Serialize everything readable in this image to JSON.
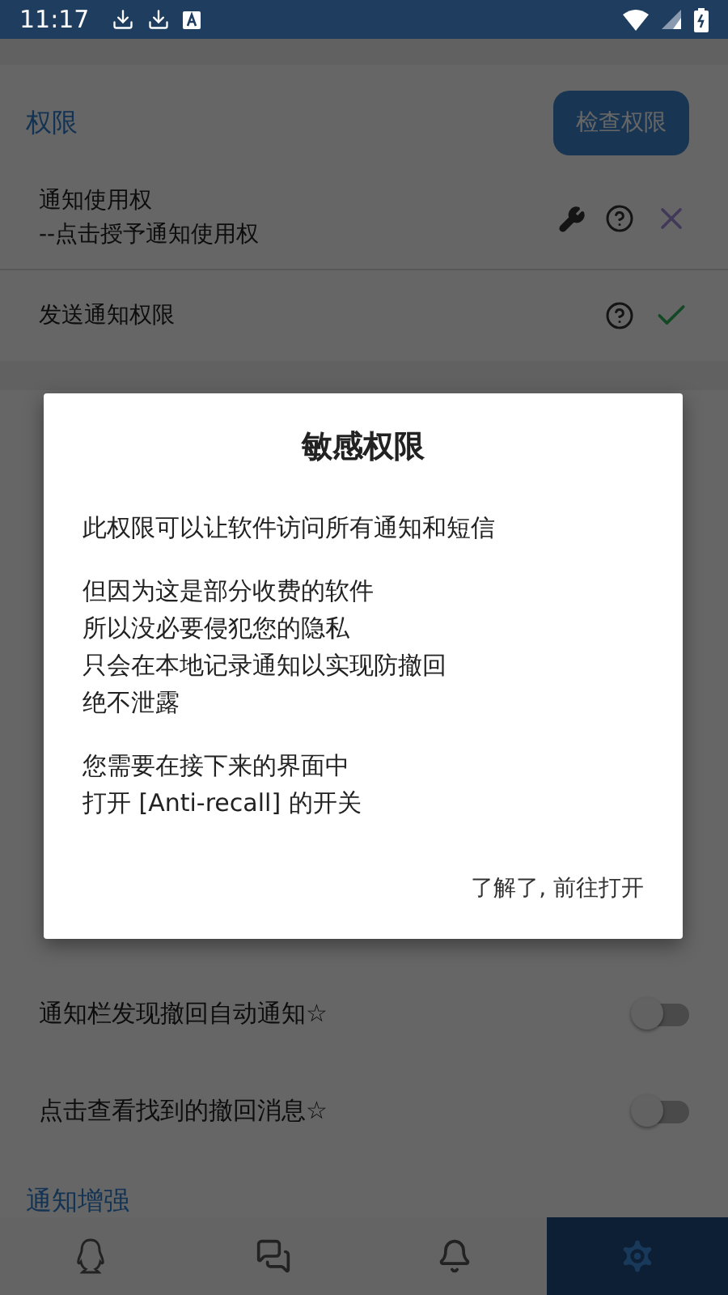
{
  "status_bar": {
    "time": "11:17"
  },
  "permissions": {
    "title": "权限",
    "check_button": "检查权限",
    "rows": [
      {
        "label": "通知使用权",
        "sublabel": "--点击授予通知使用权",
        "fixable": true,
        "granted": false
      },
      {
        "label": "发送通知权限",
        "fixable": false,
        "granted": true
      }
    ]
  },
  "toggles": [
    {
      "label": "通知栏发现撤回自动通知☆",
      "on": false
    },
    {
      "label": "点击查看找到的撤回消息☆",
      "on": false
    }
  ],
  "next_section": {
    "title": "通知增强"
  },
  "nav": [
    {
      "kind": "qq",
      "selected": false
    },
    {
      "kind": "wechat",
      "selected": false
    },
    {
      "kind": "bell",
      "selected": false
    },
    {
      "kind": "settings",
      "selected": true
    }
  ],
  "dialog": {
    "title": "敏感权限",
    "paragraphs": [
      [
        "此权限可以让软件访问所有通知和短信"
      ],
      [
        "但因为这是部分收费的软件",
        "所以没必要侵犯您的隐私",
        "只会在本地记录通知以实现防撤回",
        "绝不泄露"
      ],
      [
        "您需要在接下来的界面中",
        "打开 [Anti-recall] 的开关"
      ]
    ],
    "button": "了解了, 前往打开"
  }
}
